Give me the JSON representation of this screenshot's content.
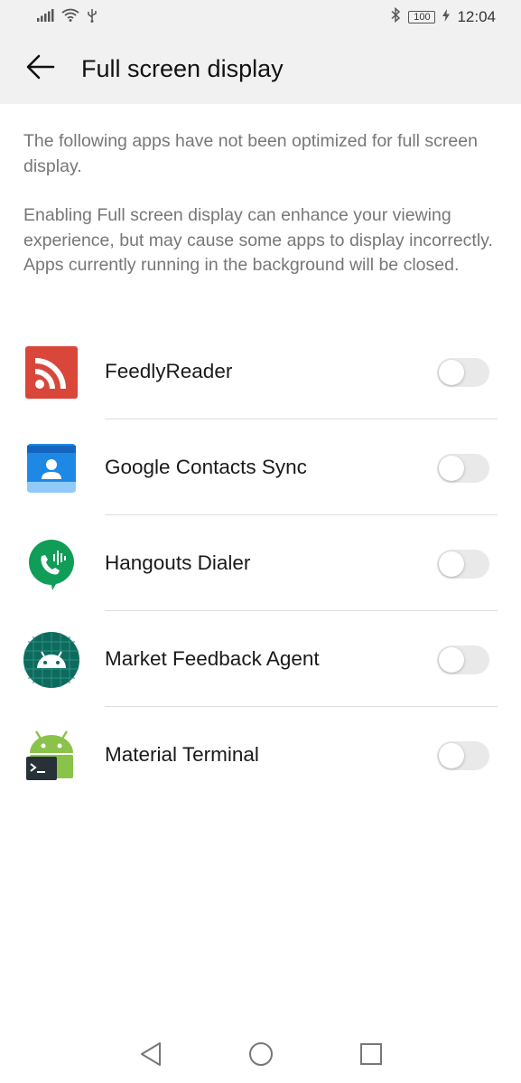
{
  "status_bar": {
    "time": "12:04",
    "battery_level": "100",
    "icons": [
      "signal-icon",
      "wifi-icon",
      "usb-icon",
      "bluetooth-icon",
      "battery-icon",
      "charging-icon"
    ]
  },
  "header": {
    "title": "Full screen display",
    "back_icon": "arrow-left-icon"
  },
  "description": {
    "line1": "The following apps have not been optimized for full screen display.",
    "line2": "Enabling Full screen display can enhance your viewing experience, but may cause some apps to display incorrectly. Apps currently running in the background will be closed."
  },
  "apps": [
    {
      "name": "FeedlyReader",
      "icon": "rss-icon",
      "enabled": false
    },
    {
      "name": "Google Contacts Sync",
      "icon": "contacts-icon",
      "enabled": false
    },
    {
      "name": "Hangouts Dialer",
      "icon": "hangouts-dialer-icon",
      "enabled": false
    },
    {
      "name": "Market Feedback Agent",
      "icon": "android-icon",
      "enabled": false
    },
    {
      "name": "Material Terminal",
      "icon": "terminal-icon",
      "enabled": false
    }
  ],
  "colors": {
    "bar_background": "#f1f1f1",
    "toggle_off": "#e9e9e9",
    "feedly_red": "#d9463a",
    "contacts_blue": "#1e88e5",
    "hangouts_green": "#0f9d58",
    "android_teal": "#0d6b5e",
    "android_green": "#8bc34a"
  },
  "nav_bar": {
    "icons": [
      "back-triangle-icon",
      "home-circle-icon",
      "recents-square-icon"
    ]
  }
}
